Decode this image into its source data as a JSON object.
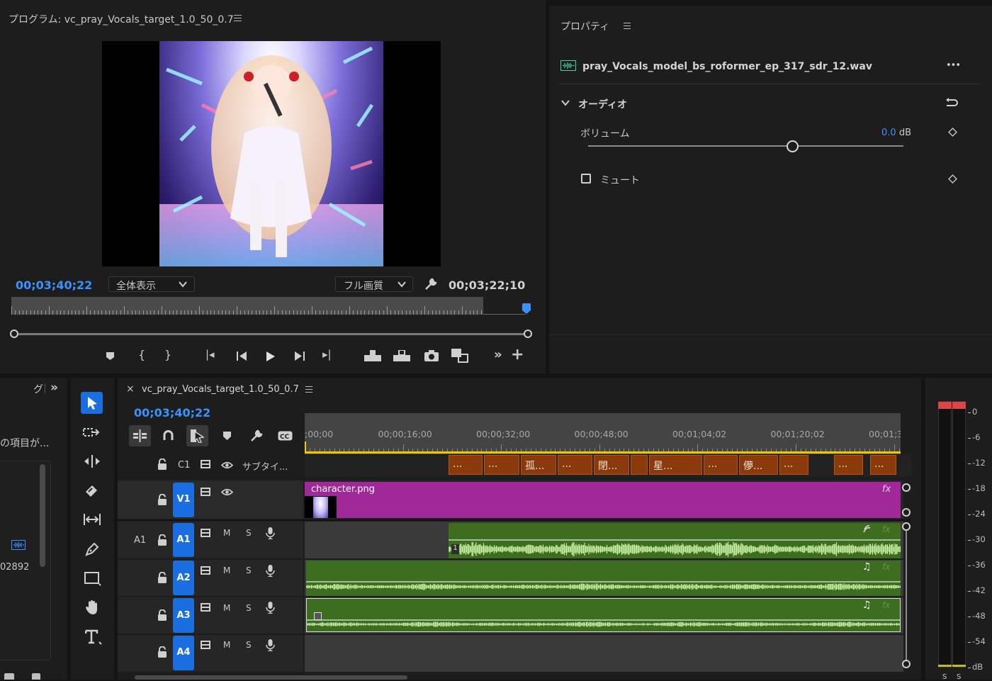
{
  "program_monitor": {
    "title": "プログラム: vc_pray_Vocals_target_1.0_50_0.7",
    "menu_icon": "hamburger-icon",
    "timecode_current": "00;03;40;22",
    "zoom_select": "全体表示",
    "quality_select": "フル画質",
    "timecode_duration": "00;03;22;10",
    "controls": [
      "marker-icon",
      "mark-in-icon",
      "mark-out-icon",
      "go-to-in-icon",
      "step-back-icon",
      "play-icon",
      "step-forward-icon",
      "go-to-out-icon",
      "lift-icon",
      "extract-icon",
      "export-frame-icon",
      "comparison-view-icon",
      "more-icon",
      "add-icon"
    ]
  },
  "properties": {
    "title": "プロパティ",
    "filename": "pray_Vocals_model_bs_roformer_ep_317_sdr_12.wav",
    "more": "•••",
    "section": "オーディオ",
    "volume_label": "ボリューム",
    "volume_value": "0.0",
    "volume_unit": "dB",
    "volume_slider_fraction": 0.7,
    "mute_label": "ミュート"
  },
  "project_panel": {
    "tab_partial": "グ",
    "expand": "»",
    "items_text": "の項目が...",
    "number": "02892"
  },
  "timeline": {
    "close": "×",
    "sequence_name": "vc_pray_Vocals_target_1.0_50_0.7",
    "timecode": "00;03;40;22",
    "ruler_labels": [
      ";00;00",
      "00;00;16;00",
      "00;00;32;00",
      "00;00;48;00",
      "00;01;04;02",
      "00;01;20;02",
      "00;01;3"
    ],
    "caption_track": {
      "name": "C1",
      "label": "サブタイ..."
    },
    "tracks": {
      "v1": "V1",
      "a1_source": "A1",
      "a1": "A1",
      "a2": "A2",
      "a3": "A3",
      "a4": "A4",
      "m": "M",
      "s": "S"
    },
    "video_clip": {
      "name": "character.png",
      "fx": "fx"
    },
    "subtitles": [
      "...",
      "...",
      "孤...",
      "...",
      "閉...",
      "",
      "星...",
      "...",
      "儚...",
      "...",
      "...",
      "..."
    ],
    "audio_clip_badge": "1"
  },
  "audio_meter": {
    "scale": [
      "0",
      "-6",
      "-12",
      "-18",
      "-24",
      "-30",
      "-36",
      "-42",
      "-48",
      "-54",
      "dB"
    ],
    "channels": [
      "S",
      "S"
    ]
  },
  "colors": {
    "accent_blue": "#3a92ff",
    "track_blue": "#1a6ee0",
    "video_clip": "#a12899",
    "audio_clip": "#3d6d1e",
    "waveform": "#c9f0a6",
    "subtitle": "#8a3a0c",
    "playhead": "#f0c800"
  }
}
